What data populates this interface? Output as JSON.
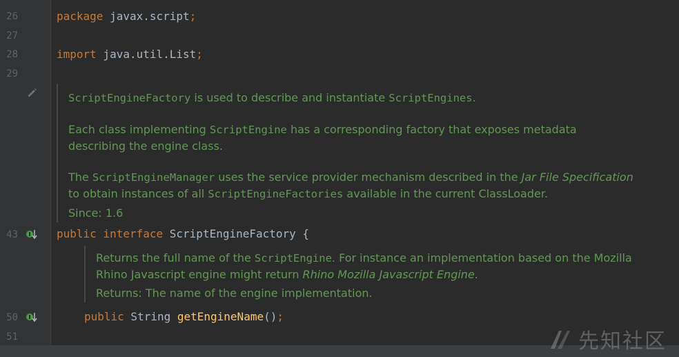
{
  "gutter": {
    "line_numbers": [
      "26",
      "27",
      "28",
      "29",
      "43",
      "50",
      "51"
    ],
    "icons": [
      "pencil-icon",
      "implemented-method-icon",
      "implemented-method-icon"
    ]
  },
  "code": {
    "line26": {
      "keyword": "package",
      "rest": " javax.script",
      "semi": ";"
    },
    "line28": {
      "keyword": "import",
      "rest": " java.util.List",
      "semi": ";"
    },
    "line43": {
      "kw1": "public",
      "kw2": "interface",
      "rest": " ScriptEngineFactory {"
    },
    "line50": {
      "kw1": "public",
      "type": " String ",
      "method": "getEngineName",
      "rest": "()",
      "semi": ";"
    }
  },
  "doc1": {
    "p1_code": "ScriptEngineFactory",
    "p1_text1": " is used to describe and instantiate ",
    "p1_code2": "ScriptEngines",
    "p1_text2": ".",
    "p2_text1": "Each class implementing ",
    "p2_code": "ScriptEngine",
    "p2_text2": " has a corresponding factory that exposes metadata describing the engine class.",
    "p3_text1": "The ",
    "p3_code": "ScriptEngineManager",
    "p3_text2": " uses the service provider mechanism described in the ",
    "p3_em": "Jar File Specification",
    "p3_text3": " to obtain instances of all ",
    "p3_code2": "ScriptEngineFactories",
    "p3_text4": " available in the current ClassLoader.",
    "since": "Since: 1.6"
  },
  "doc2": {
    "p1_text1": "Returns the full name of the ",
    "p1_code": "ScriptEngine",
    "p1_text2": ". For instance an implementation based on the Mozilla Rhino Javascript engine might return ",
    "p1_em": "Rhino Mozilla Javascript Engine",
    "p1_text3": ".",
    "returns": "Returns: The name of the engine implementation."
  },
  "watermark": {
    "text": "先知社区"
  },
  "colors": {
    "background": "#2b2b2b",
    "keyword": "#cc7832",
    "method": "#ffc66d",
    "doc": "#629755",
    "plain": "#a9b7c6",
    "line_number": "#606366"
  }
}
